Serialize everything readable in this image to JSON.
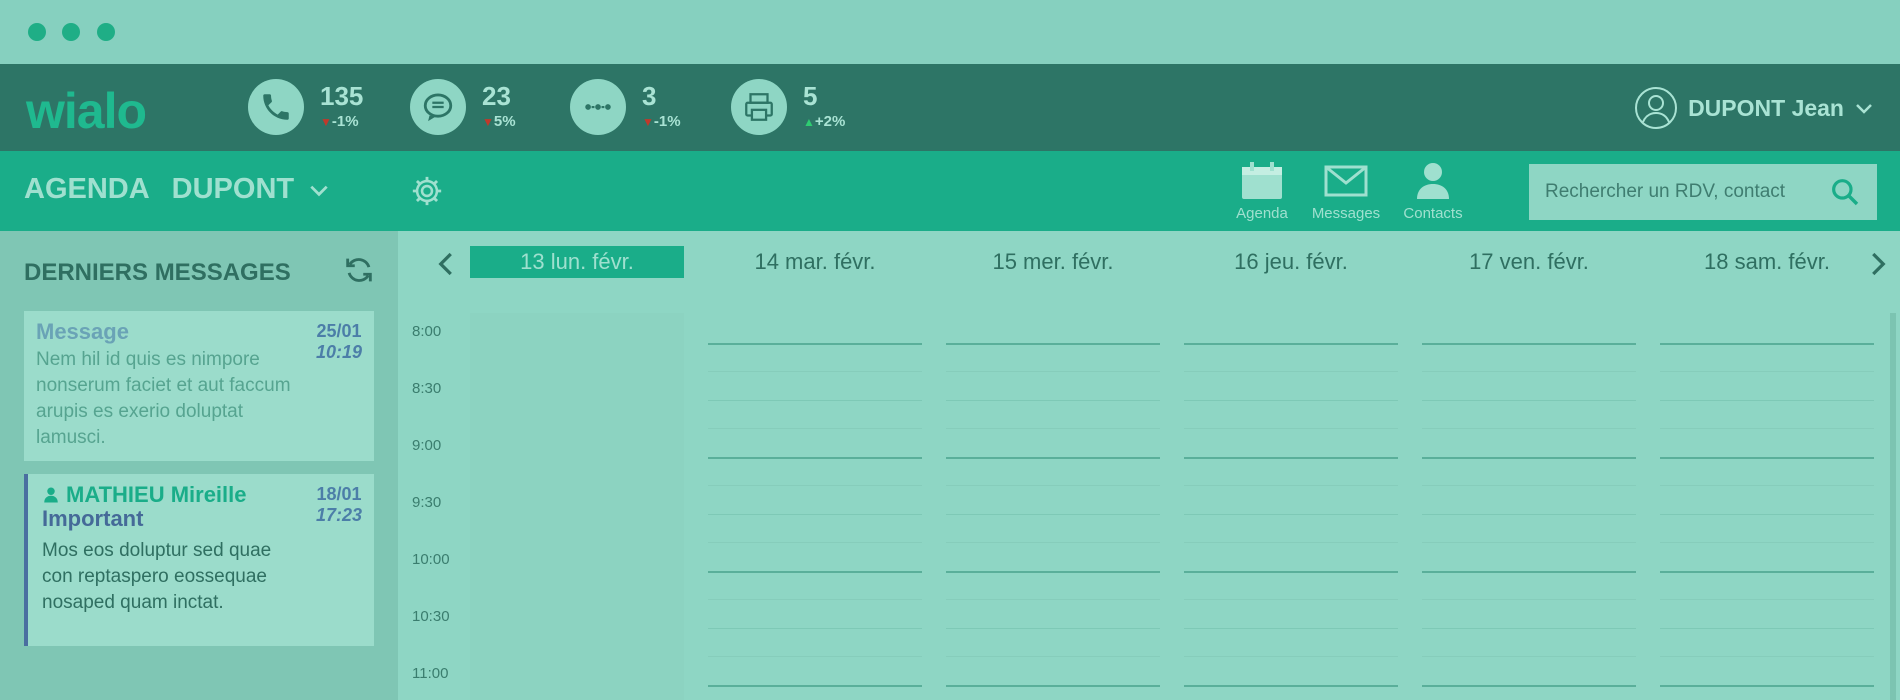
{
  "colors": {
    "window_bg": "#86d0bf",
    "stats_bar": "#2d7566",
    "agenda_bar": "#1aad89",
    "accent": "#1aad89",
    "sidebar_bg": "#7fc6b4",
    "calendar_bg": "#8ed6c4",
    "trend_down": "#c0392b",
    "trend_up": "#2ecc71"
  },
  "app": {
    "logo": "wialo"
  },
  "stats": [
    {
      "icon": "phone-icon",
      "count": "135",
      "trend_dir": "down",
      "trend": "-1%"
    },
    {
      "icon": "chat-icon",
      "count": "23",
      "trend_dir": "down",
      "trend": "5%"
    },
    {
      "icon": "transfer-icon",
      "count": "3",
      "trend_dir": "down",
      "trend": "-1%"
    },
    {
      "icon": "fax-icon",
      "count": "5",
      "trend_dir": "up",
      "trend": "+2%"
    }
  ],
  "user": {
    "name": "DUPONT Jean"
  },
  "agenda_bar": {
    "title": "AGENDA",
    "owner": "DUPONT",
    "nav": [
      {
        "icon": "calendar-icon",
        "label": "Agenda"
      },
      {
        "icon": "envelope-icon",
        "label": "Messages"
      },
      {
        "icon": "person-icon",
        "label": "Contacts"
      }
    ],
    "search_placeholder": "Rechercher un RDV, contact"
  },
  "sidebar": {
    "title": "DERNIERS MESSAGES",
    "messages": [
      {
        "title": "Message",
        "text": "Nem hil id quis es nimpore nonserum faciet et aut faccum arupis es exerio doluptat lamusci.",
        "date": "25/01",
        "time": "10:19"
      },
      {
        "sender": "MATHIEU Mireille",
        "title": "Important",
        "text": "Mos eos doluptur sed quae con reptaspero eossequae nosaped quam inctat.",
        "date": "18/01",
        "time": "17:23"
      }
    ]
  },
  "calendar": {
    "days": [
      "13 lun. févr.",
      "14 mar. févr.",
      "15 mer. févr.",
      "16 jeu. févr.",
      "17 ven. févr.",
      "18 sam. févr."
    ],
    "active_day_index": 0,
    "times": [
      "8:00",
      "8:30",
      "9:00",
      "9:30",
      "10:00",
      "10:30",
      "11:00"
    ]
  }
}
